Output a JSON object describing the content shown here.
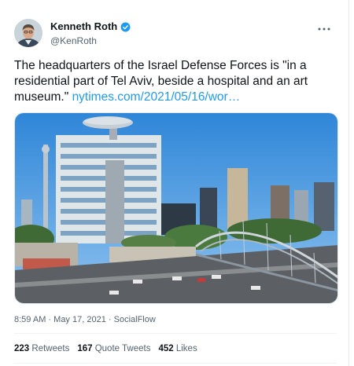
{
  "author": {
    "name": "Kenneth Roth",
    "handle": "@KenRoth",
    "verified": true
  },
  "more_icon": "more-horizontal-icon",
  "tweet": {
    "text": "The headquarters of the Israel Defense Forces is \"in a residential part of Tel Aviv, beside a hospital and an art museum.\"",
    "link": "nytimes.com/2021/05/16/wor…"
  },
  "media": {
    "kind": "photo"
  },
  "meta": {
    "time": "8:59 AM",
    "date": "May 17, 2021",
    "source": "SocialFlow",
    "separator": "·"
  },
  "stats": {
    "retweets_count": "223",
    "retweets_label": "Retweets",
    "quotes_count": "167",
    "quotes_label": "Quote Tweets",
    "likes_count": "452",
    "likes_label": "Likes"
  },
  "colors": {
    "link": "#1d9bf0",
    "verified": "#1d9bf0",
    "muted": "#536471"
  }
}
